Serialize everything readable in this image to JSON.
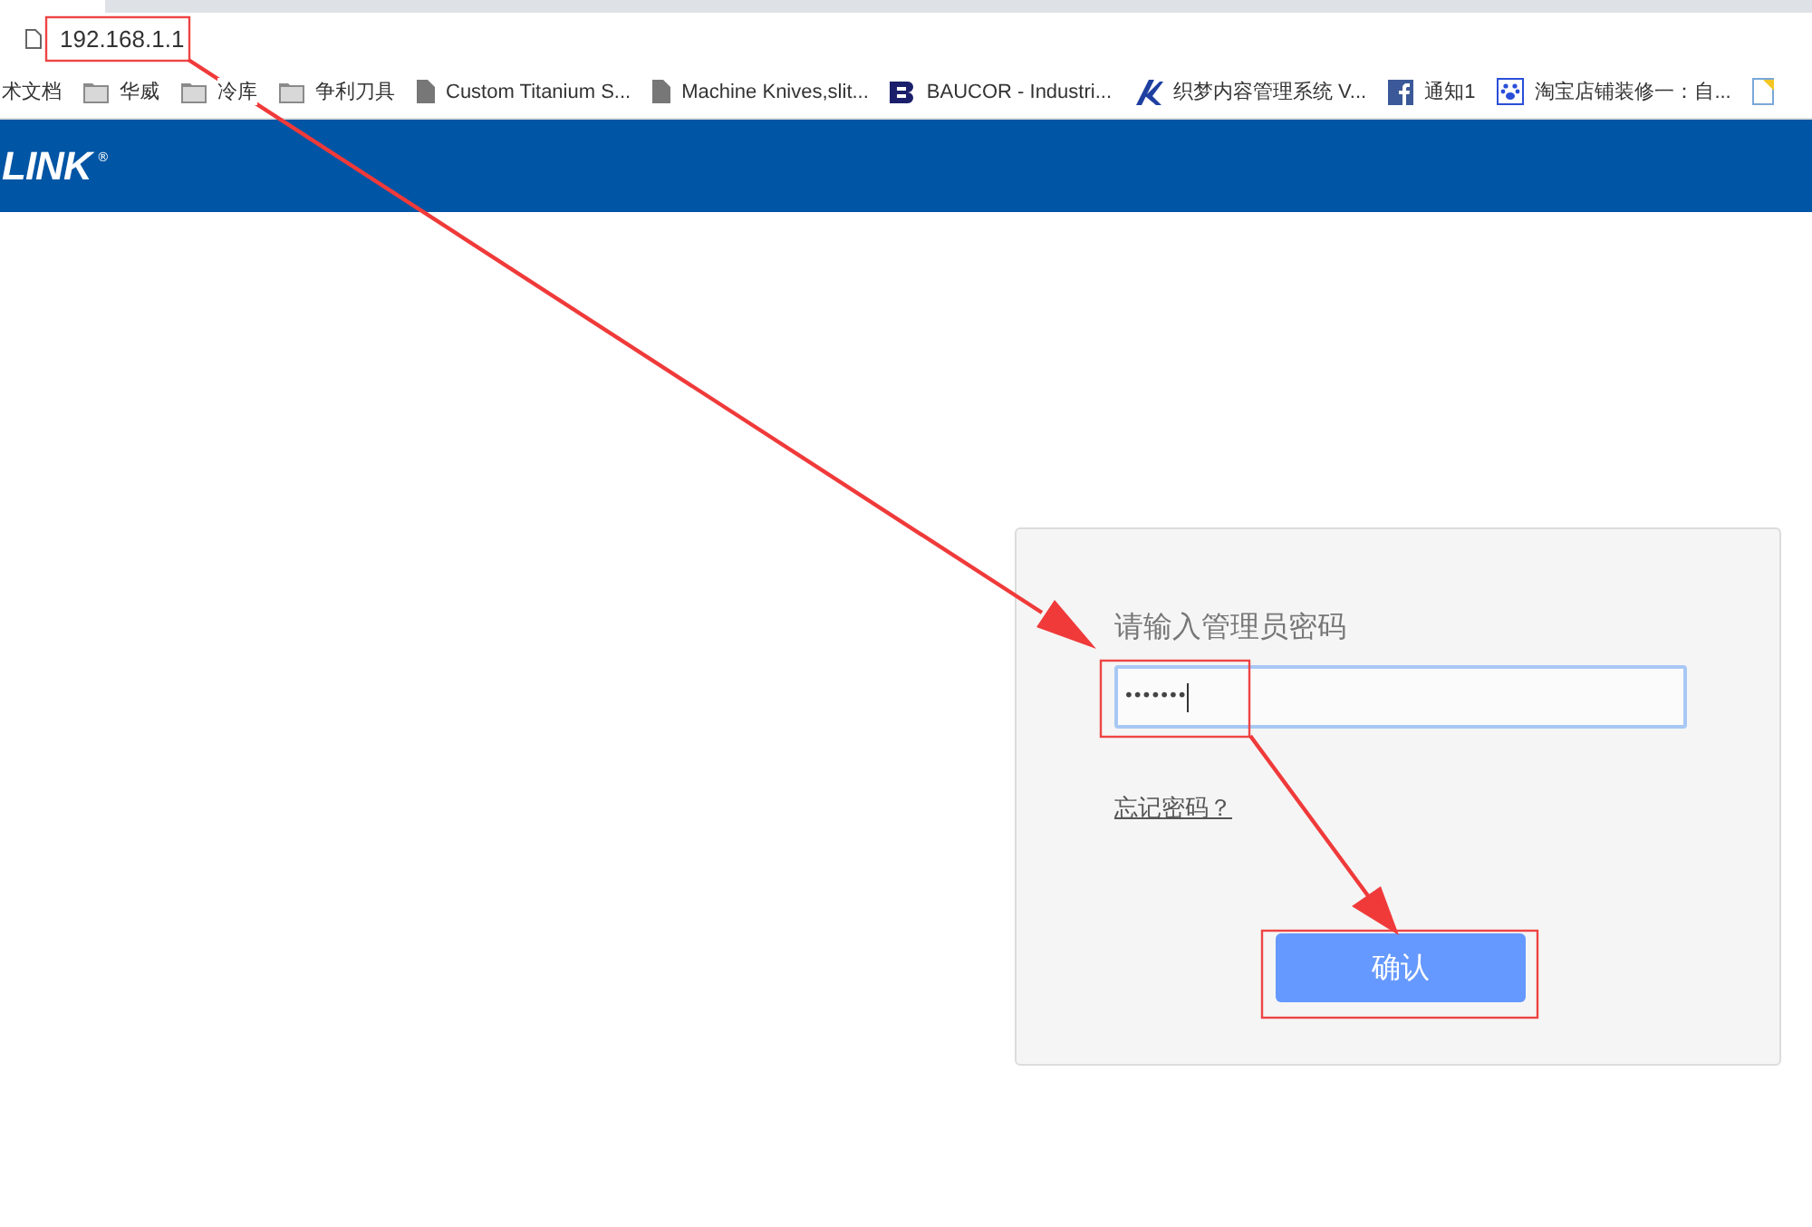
{
  "address_bar": {
    "url": "192.168.1.1"
  },
  "bookmarks": [
    {
      "kind": "plain",
      "label": "术文档"
    },
    {
      "kind": "folder",
      "label": "华威"
    },
    {
      "kind": "folder",
      "label": "冷库"
    },
    {
      "kind": "folder",
      "label": "争利刀具"
    },
    {
      "kind": "page",
      "label": "Custom Titanium S..."
    },
    {
      "kind": "page",
      "label": "Machine Knives,slit..."
    },
    {
      "kind": "baucor",
      "label": "BAUCOR - Industri..."
    },
    {
      "kind": "dede",
      "label": "织梦内容管理系统 V..."
    },
    {
      "kind": "facebook",
      "label": "通知1"
    },
    {
      "kind": "paw",
      "label": "淘宝店铺装修一：自..."
    },
    {
      "kind": "note"
    }
  ],
  "header": {
    "logo": "LINK",
    "logo_mark": "®"
  },
  "login": {
    "prompt": "请输入管理员密码",
    "password": "•••••••",
    "forgot_link": "忘记密码？",
    "confirm_button": "确认"
  }
}
